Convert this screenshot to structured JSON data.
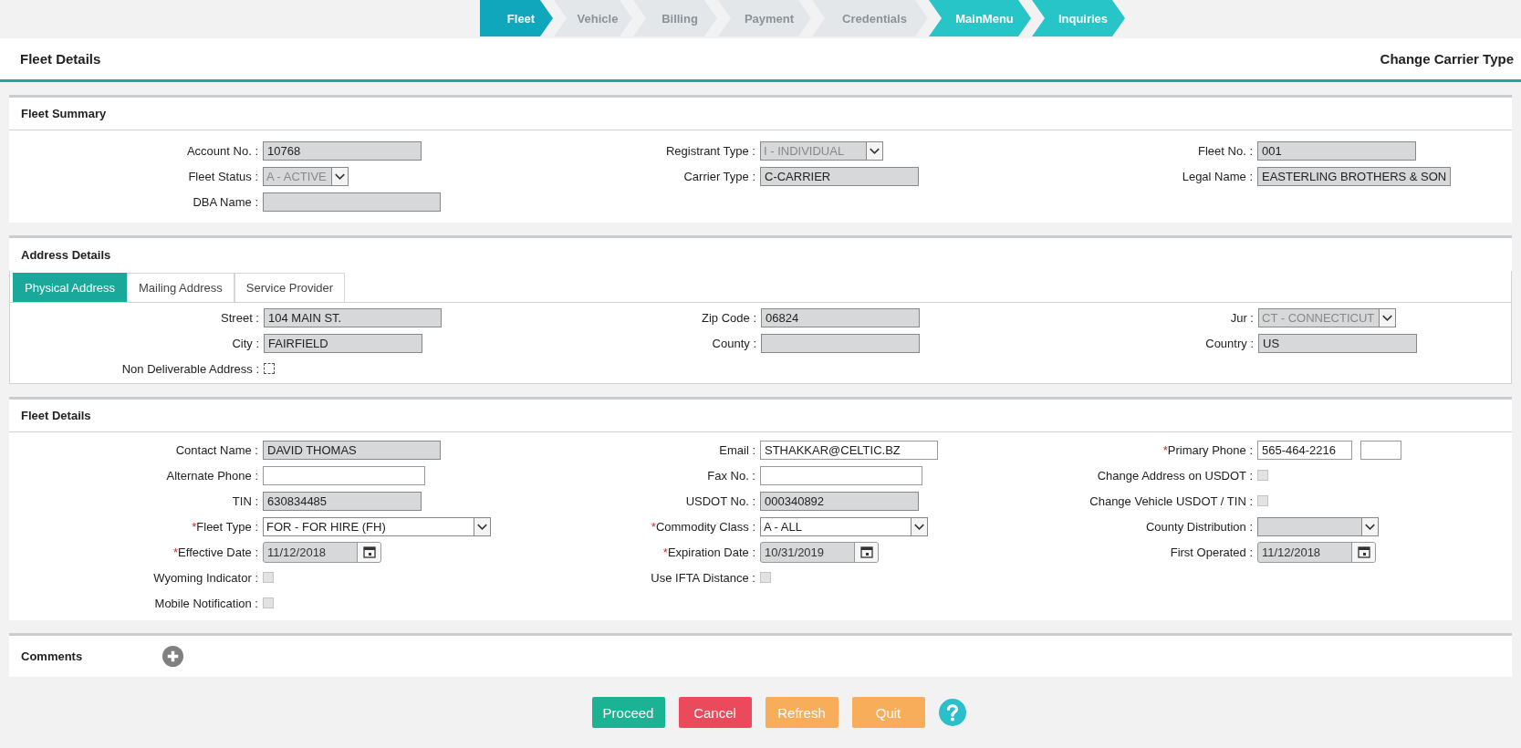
{
  "wizard": [
    {
      "label": "Fleet",
      "selected": true,
      "disabled": false
    },
    {
      "label": "Vehicle",
      "selected": false,
      "disabled": true
    },
    {
      "label": "Billing",
      "selected": false,
      "disabled": true
    },
    {
      "label": "Payment",
      "selected": false,
      "disabled": true
    },
    {
      "label": "Credentials",
      "selected": false,
      "disabled": true
    },
    {
      "label": "MainMenu",
      "selected": false,
      "disabled": false
    },
    {
      "label": "Inquiries",
      "selected": false,
      "disabled": false
    }
  ],
  "header": {
    "title": "Fleet Details",
    "action": "Change Carrier Type"
  },
  "fleet_summary": {
    "title": "Fleet Summary",
    "columns": [
      [
        {
          "kind": "text",
          "label": "Account No. :",
          "value": "10768",
          "readonly": true
        },
        {
          "kind": "select",
          "label": "Fleet Status :",
          "value": "A - ACTIVE",
          "readonly": true
        },
        {
          "kind": "text",
          "label": "DBA Name :",
          "readonly": true
        }
      ],
      [
        {
          "kind": "select",
          "label": "Registrant Type :",
          "value": "I - INDIVIDUAL",
          "readonly": true
        },
        {
          "kind": "text",
          "label": "Carrier Type :",
          "value": "C-CARRIER",
          "readonly": true
        }
      ],
      [
        {
          "kind": "text",
          "label": "Fleet No. :",
          "value": "001",
          "readonly": true
        },
        {
          "kind": "text",
          "label": "Legal Name :",
          "value": "EASTERLING BROTHERS & SON",
          "readonly": true
        }
      ]
    ]
  },
  "address_details": {
    "title": "Address Details",
    "tabs": [
      {
        "label": "Physical Address",
        "selected": true
      },
      {
        "label": "Mailing Address",
        "selected": false
      },
      {
        "label": "Service Provider",
        "selected": false
      }
    ],
    "columns": [
      [
        {
          "kind": "text",
          "label": "Street :",
          "value": "104 MAIN ST.",
          "readonly": true
        },
        {
          "kind": "text",
          "label": "City :",
          "value": "FAIRFIELD",
          "readonly": true
        },
        {
          "kind": "checkbox",
          "label": "Non Deliverable Address :",
          "checked": false,
          "readonly": false
        }
      ],
      [
        {
          "kind": "text",
          "label": "Zip Code :",
          "value": "06824",
          "readonly": true
        },
        {
          "kind": "text",
          "label": "County :",
          "readonly": true
        }
      ],
      [
        {
          "kind": "select",
          "label": "Jur :",
          "value": "CT - CONNECTICUT",
          "readonly": true
        },
        {
          "kind": "text",
          "label": "Country :",
          "value": "US",
          "readonly": true
        }
      ]
    ]
  },
  "fleet_details": {
    "title": "Fleet Details",
    "columns": [
      [
        {
          "kind": "text",
          "label": "Contact Name :",
          "value": "DAVID THOMAS",
          "readonly": true
        },
        {
          "kind": "text",
          "label": "Alternate Phone :",
          "readonly": false
        },
        {
          "kind": "text",
          "label": "TIN :",
          "value": "630834485",
          "readonly": true
        },
        {
          "kind": "select",
          "label": "Fleet Type :",
          "marker": "*",
          "value": "FOR - FOR HIRE (FH)",
          "readonly": false
        },
        {
          "kind": "date",
          "label": "Effective Date :",
          "marker": "*",
          "value": "11/12/2018",
          "readonly": true
        },
        {
          "kind": "checkbox",
          "label": "Wyoming Indicator :",
          "checked": false,
          "readonly": true
        },
        {
          "kind": "checkbox",
          "label": "Mobile Notification :",
          "checked": false,
          "readonly": true
        }
      ],
      [
        {
          "kind": "text",
          "label": "Email :",
          "value": "STHAKKAR@CELTIC.BZ",
          "readonly": false
        },
        {
          "kind": "text",
          "label": "Fax No. :",
          "readonly": false
        },
        {
          "kind": "text",
          "label": "USDOT No. :",
          "value": "000340892",
          "readonly": true
        },
        {
          "kind": "select",
          "label": "Commodity Class :",
          "marker": "*",
          "value": "A - ALL",
          "readonly": false
        },
        {
          "kind": "date",
          "label": "Expiration Date :",
          "marker": "*",
          "value": "10/31/2019",
          "readonly": true
        },
        {
          "kind": "checkbox",
          "label": "Use IFTA Distance :",
          "checked": false,
          "readonly": true
        }
      ],
      [
        {
          "kind": "phone",
          "label": "Primary Phone :",
          "marker": "*",
          "value": "565-464-2216",
          "readonly": false
        },
        {
          "kind": "checkbox",
          "label": "Change Address on USDOT :",
          "checked": false,
          "readonly": true
        },
        {
          "kind": "checkbox",
          "label": "Change Vehicle USDOT / TIN :",
          "checked": false,
          "readonly": true
        },
        {
          "kind": "select",
          "label": "County Distribution :",
          "readonly": true
        },
        {
          "kind": "date",
          "label": "First Operated :",
          "value": "11/12/2018",
          "readonly": true
        }
      ]
    ]
  },
  "comments": {
    "title": "Comments"
  },
  "buttons": [
    {
      "label": "Proceed",
      "kind": "primary"
    },
    {
      "label": "Cancel",
      "kind": "danger"
    },
    {
      "label": "Refresh",
      "kind": "warning"
    },
    {
      "label": "Quit",
      "kind": "warning"
    }
  ]
}
